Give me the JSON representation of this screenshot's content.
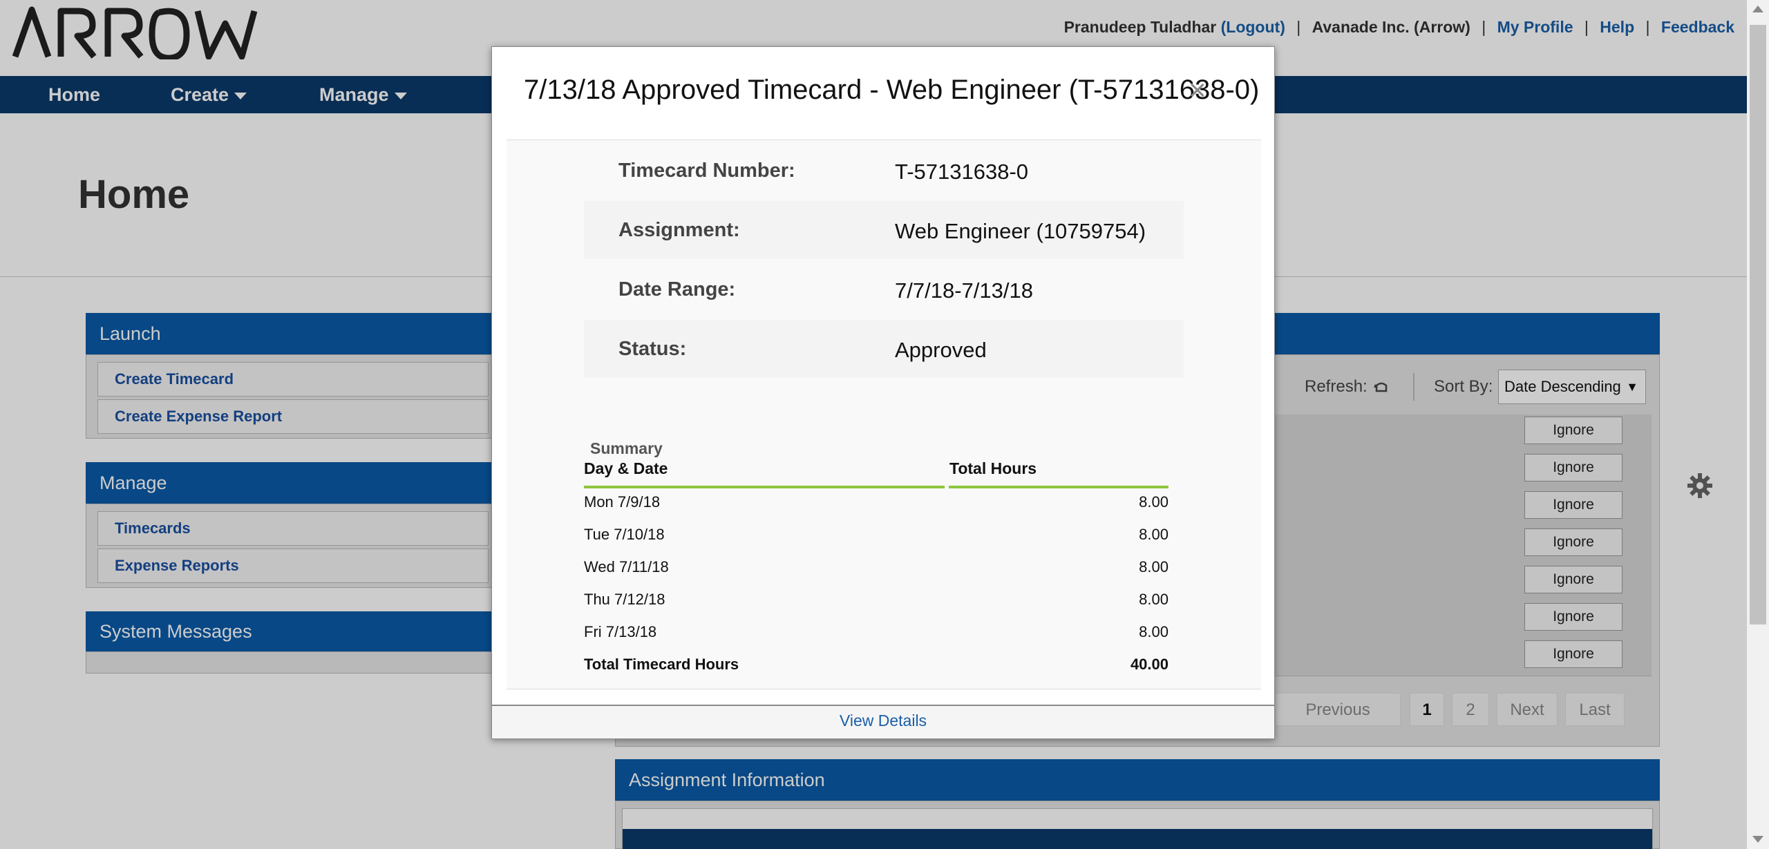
{
  "header": {
    "logo_text": "ARROW",
    "user_name": "Pranudeep Tuladhar",
    "logout": "(Logout)",
    "company": "Avanade Inc. (Arrow)",
    "my_profile": "My Profile",
    "help": "Help",
    "feedback": "Feedback"
  },
  "nav": {
    "home": "Home",
    "create": "Create",
    "manage": "Manage"
  },
  "page": {
    "title": "Home"
  },
  "launch": {
    "title": "Launch",
    "items": [
      "Create Timecard",
      "Create Expense Report"
    ]
  },
  "manage_panel": {
    "title": "Manage",
    "items": [
      "Timecards",
      "Expense Reports"
    ]
  },
  "system_messages": {
    "title": "System Messages"
  },
  "right_panel": {
    "refresh_label": "Refresh:",
    "sort_label": "Sort By:",
    "sort_value": "Date Descending",
    "ignore_label": "Ignore",
    "pager": {
      "previous": "Previous",
      "page1": "1",
      "page2": "2",
      "next": "Next",
      "last": "Last"
    }
  },
  "assignment_info": {
    "title": "Assignment Information"
  },
  "modal": {
    "title": "7/13/18 Approved Timecard - Web Engineer (T-57131638-0)",
    "close_glyph": "×",
    "fields": [
      {
        "label": "Timecard Number:",
        "value": "T-57131638-0"
      },
      {
        "label": "Assignment:",
        "value": "Web Engineer (10759754)"
      },
      {
        "label": "Date Range:",
        "value": "7/7/18-7/13/18"
      },
      {
        "label": "Status:",
        "value": "Approved"
      }
    ],
    "summary_label": "Summary",
    "summary_headers": {
      "day": "Day & Date",
      "hours": "Total Hours"
    },
    "summary_rows": [
      {
        "day": "Mon 7/9/18",
        "hours": "8.00"
      },
      {
        "day": "Tue 7/10/18",
        "hours": "8.00"
      },
      {
        "day": "Wed 7/11/18",
        "hours": "8.00"
      },
      {
        "day": "Thu 7/12/18",
        "hours": "8.00"
      },
      {
        "day": "Fri 7/13/18",
        "hours": "8.00"
      }
    ],
    "summary_total": {
      "label": "Total Timecard Hours",
      "hours": "40.00"
    },
    "view_details": "View Details"
  },
  "colors": {
    "nav_bg": "#0a3a6b",
    "panel_header": "#0a5aa8",
    "link": "#1a5fa8",
    "table_underline": "#8dc63f"
  },
  "icons": [
    "refresh-icon",
    "gear-icon",
    "close-icon",
    "chevron-down-icon",
    "sort-dropdown-arrow-icon"
  ]
}
